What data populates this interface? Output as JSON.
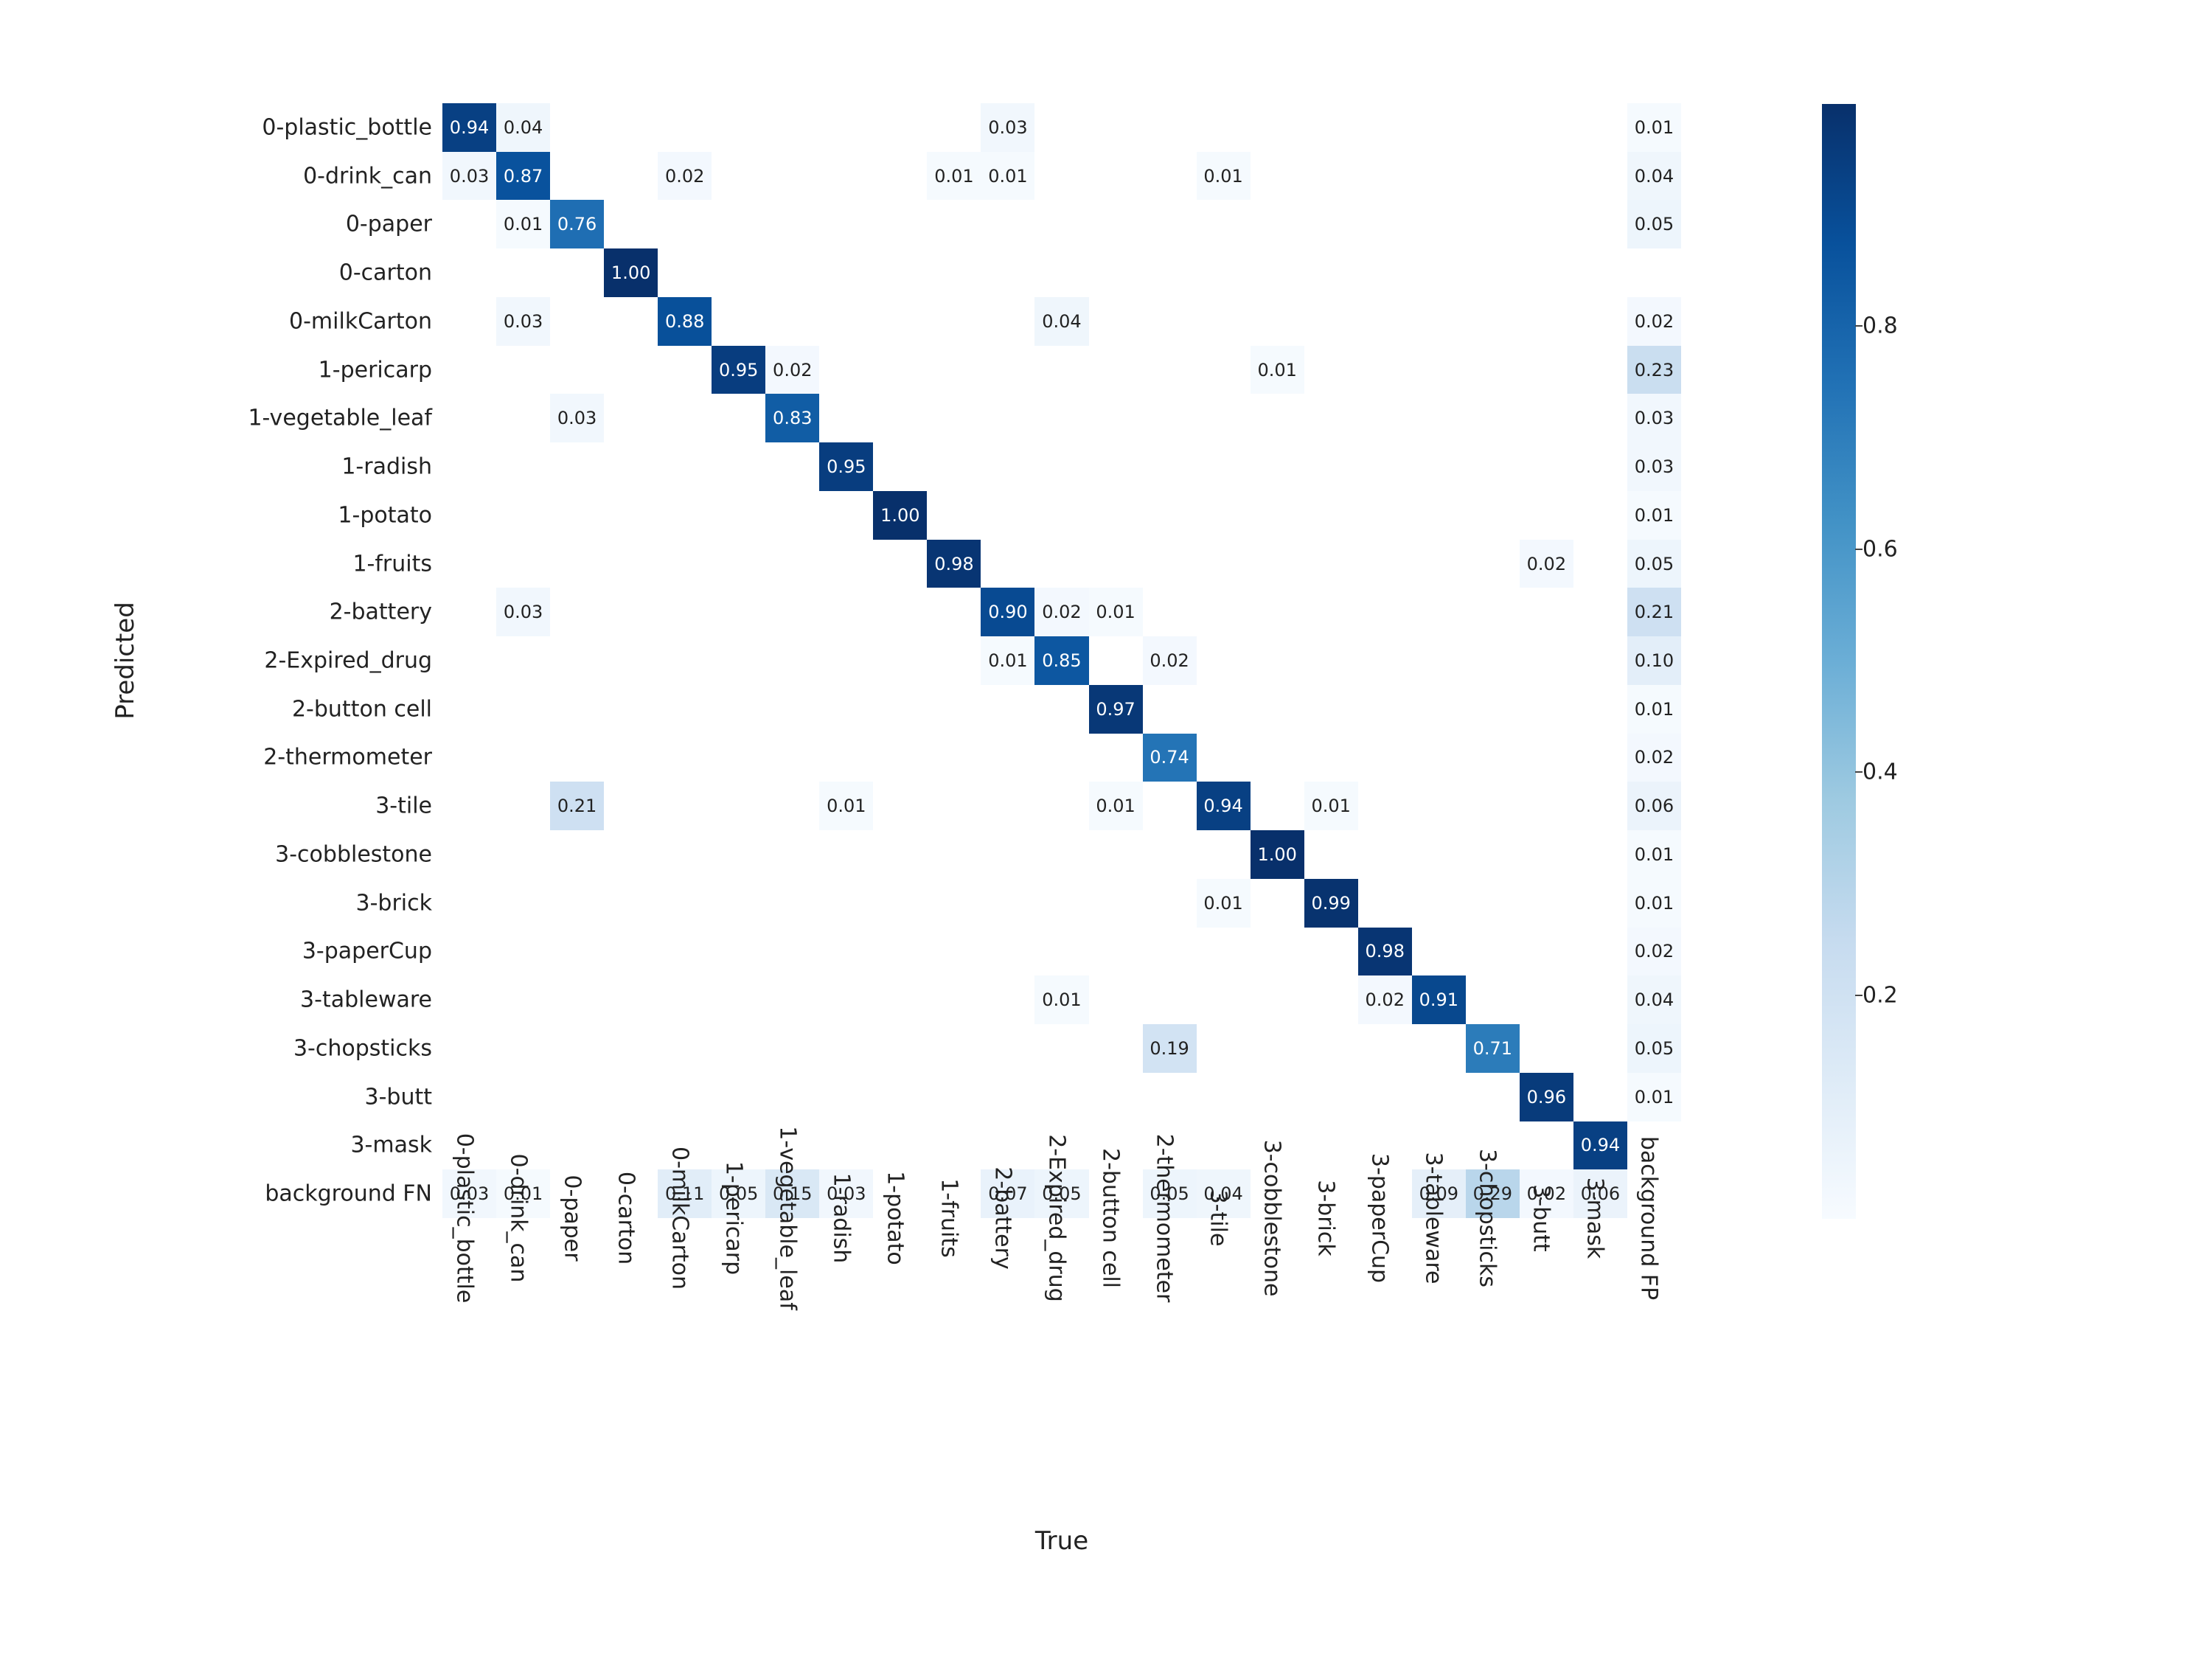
{
  "chart_data": {
    "type": "heatmap",
    "xlabel": "True",
    "ylabel": "Predicted",
    "row_labels": [
      "0-plastic_bottle",
      "0-drink_can",
      "0-paper",
      "0-carton",
      "0-milkCarton",
      "1-pericarp",
      "1-vegetable_leaf",
      "1-radish",
      "1-potato",
      "1-fruits",
      "2-battery",
      "2-Expired_drug",
      "2-button cell",
      "2-thermometer",
      "3-tile",
      "3-cobblestone",
      "3-brick",
      "3-paperCup",
      "3-tableware",
      "3-chopsticks",
      "3-butt",
      "3-mask",
      "background FN"
    ],
    "col_labels": [
      "0-plastic_bottle",
      "0-drink_can",
      "0-paper",
      "0-carton",
      "0-milkCarton",
      "1-pericarp",
      "1-vegetable_leaf",
      "1-radish",
      "1-potato",
      "1-fruits",
      "2-battery",
      "2-Expired_drug",
      "2-button cell",
      "2-thermometer",
      "3-tile",
      "3-cobblestone",
      "3-brick",
      "3-paperCup",
      "3-tableware",
      "3-chopsticks",
      "3-butt",
      "3-mask",
      "background FP"
    ],
    "cells": [
      {
        "r": 0,
        "c": 0,
        "v": 0.94
      },
      {
        "r": 0,
        "c": 1,
        "v": 0.04
      },
      {
        "r": 0,
        "c": 10,
        "v": 0.03
      },
      {
        "r": 0,
        "c": 22,
        "v": 0.01
      },
      {
        "r": 1,
        "c": 0,
        "v": 0.03
      },
      {
        "r": 1,
        "c": 1,
        "v": 0.87
      },
      {
        "r": 1,
        "c": 4,
        "v": 0.02
      },
      {
        "r": 1,
        "c": 9,
        "v": 0.01
      },
      {
        "r": 1,
        "c": 10,
        "v": 0.01
      },
      {
        "r": 1,
        "c": 14,
        "v": 0.01
      },
      {
        "r": 1,
        "c": 22,
        "v": 0.04
      },
      {
        "r": 2,
        "c": 1,
        "v": 0.01
      },
      {
        "r": 2,
        "c": 2,
        "v": 0.76
      },
      {
        "r": 2,
        "c": 22,
        "v": 0.05
      },
      {
        "r": 3,
        "c": 3,
        "v": 1.0
      },
      {
        "r": 4,
        "c": 1,
        "v": 0.03
      },
      {
        "r": 4,
        "c": 4,
        "v": 0.88
      },
      {
        "r": 4,
        "c": 11,
        "v": 0.04
      },
      {
        "r": 4,
        "c": 22,
        "v": 0.02
      },
      {
        "r": 5,
        "c": 5,
        "v": 0.95
      },
      {
        "r": 5,
        "c": 6,
        "v": 0.02
      },
      {
        "r": 5,
        "c": 15,
        "v": 0.01
      },
      {
        "r": 5,
        "c": 22,
        "v": 0.23
      },
      {
        "r": 6,
        "c": 2,
        "v": 0.03
      },
      {
        "r": 6,
        "c": 6,
        "v": 0.83
      },
      {
        "r": 6,
        "c": 22,
        "v": 0.03
      },
      {
        "r": 7,
        "c": 7,
        "v": 0.95
      },
      {
        "r": 7,
        "c": 22,
        "v": 0.03
      },
      {
        "r": 8,
        "c": 8,
        "v": 1.0
      },
      {
        "r": 8,
        "c": 22,
        "v": 0.01
      },
      {
        "r": 9,
        "c": 9,
        "v": 0.98
      },
      {
        "r": 9,
        "c": 20,
        "v": 0.02
      },
      {
        "r": 9,
        "c": 22,
        "v": 0.05
      },
      {
        "r": 10,
        "c": 1,
        "v": 0.03
      },
      {
        "r": 10,
        "c": 10,
        "v": 0.9
      },
      {
        "r": 10,
        "c": 11,
        "v": 0.02
      },
      {
        "r": 10,
        "c": 12,
        "v": 0.01
      },
      {
        "r": 10,
        "c": 22,
        "v": 0.21
      },
      {
        "r": 11,
        "c": 10,
        "v": 0.01
      },
      {
        "r": 11,
        "c": 11,
        "v": 0.85
      },
      {
        "r": 11,
        "c": 13,
        "v": 0.02
      },
      {
        "r": 11,
        "c": 22,
        "v": 0.1
      },
      {
        "r": 12,
        "c": 12,
        "v": 0.97
      },
      {
        "r": 12,
        "c": 22,
        "v": 0.01
      },
      {
        "r": 13,
        "c": 13,
        "v": 0.74
      },
      {
        "r": 13,
        "c": 22,
        "v": 0.02
      },
      {
        "r": 14,
        "c": 2,
        "v": 0.21
      },
      {
        "r": 14,
        "c": 7,
        "v": 0.01
      },
      {
        "r": 14,
        "c": 12,
        "v": 0.01
      },
      {
        "r": 14,
        "c": 14,
        "v": 0.94
      },
      {
        "r": 14,
        "c": 16,
        "v": 0.01
      },
      {
        "r": 14,
        "c": 22,
        "v": 0.06
      },
      {
        "r": 15,
        "c": 15,
        "v": 1.0
      },
      {
        "r": 15,
        "c": 22,
        "v": 0.01
      },
      {
        "r": 16,
        "c": 14,
        "v": 0.01
      },
      {
        "r": 16,
        "c": 16,
        "v": 0.99
      },
      {
        "r": 16,
        "c": 22,
        "v": 0.01
      },
      {
        "r": 17,
        "c": 17,
        "v": 0.98
      },
      {
        "r": 17,
        "c": 22,
        "v": 0.02
      },
      {
        "r": 18,
        "c": 11,
        "v": 0.01
      },
      {
        "r": 18,
        "c": 17,
        "v": 0.02
      },
      {
        "r": 18,
        "c": 18,
        "v": 0.91
      },
      {
        "r": 18,
        "c": 22,
        "v": 0.04
      },
      {
        "r": 19,
        "c": 13,
        "v": 0.19
      },
      {
        "r": 19,
        "c": 19,
        "v": 0.71
      },
      {
        "r": 19,
        "c": 22,
        "v": 0.05
      },
      {
        "r": 20,
        "c": 20,
        "v": 0.96
      },
      {
        "r": 20,
        "c": 22,
        "v": 0.01
      },
      {
        "r": 21,
        "c": 21,
        "v": 0.94
      },
      {
        "r": 22,
        "c": 0,
        "v": 0.03
      },
      {
        "r": 22,
        "c": 1,
        "v": 0.01
      },
      {
        "r": 22,
        "c": 4,
        "v": 0.11
      },
      {
        "r": 22,
        "c": 5,
        "v": 0.05
      },
      {
        "r": 22,
        "c": 6,
        "v": 0.15
      },
      {
        "r": 22,
        "c": 7,
        "v": 0.03
      },
      {
        "r": 22,
        "c": 10,
        "v": 0.07
      },
      {
        "r": 22,
        "c": 11,
        "v": 0.05
      },
      {
        "r": 22,
        "c": 13,
        "v": 0.05
      },
      {
        "r": 22,
        "c": 14,
        "v": 0.04
      },
      {
        "r": 22,
        "c": 18,
        "v": 0.09
      },
      {
        "r": 22,
        "c": 19,
        "v": 0.29
      },
      {
        "r": 22,
        "c": 20,
        "v": 0.02
      },
      {
        "r": 22,
        "c": 21,
        "v": 0.06
      }
    ],
    "colorbar_ticks": [
      0.2,
      0.4,
      0.6,
      0.8
    ],
    "vmin": 0.0,
    "vmax": 1.0,
    "text_color_threshold": 0.5,
    "colormap_stops": [
      {
        "t": 0.0,
        "color": "#f7fbff"
      },
      {
        "t": 0.125,
        "color": "#deebf7"
      },
      {
        "t": 0.25,
        "color": "#c6dbef"
      },
      {
        "t": 0.375,
        "color": "#9ecae1"
      },
      {
        "t": 0.5,
        "color": "#6baed6"
      },
      {
        "t": 0.625,
        "color": "#4292c6"
      },
      {
        "t": 0.75,
        "color": "#2171b5"
      },
      {
        "t": 0.875,
        "color": "#08519c"
      },
      {
        "t": 1.0,
        "color": "#08306b"
      }
    ]
  }
}
